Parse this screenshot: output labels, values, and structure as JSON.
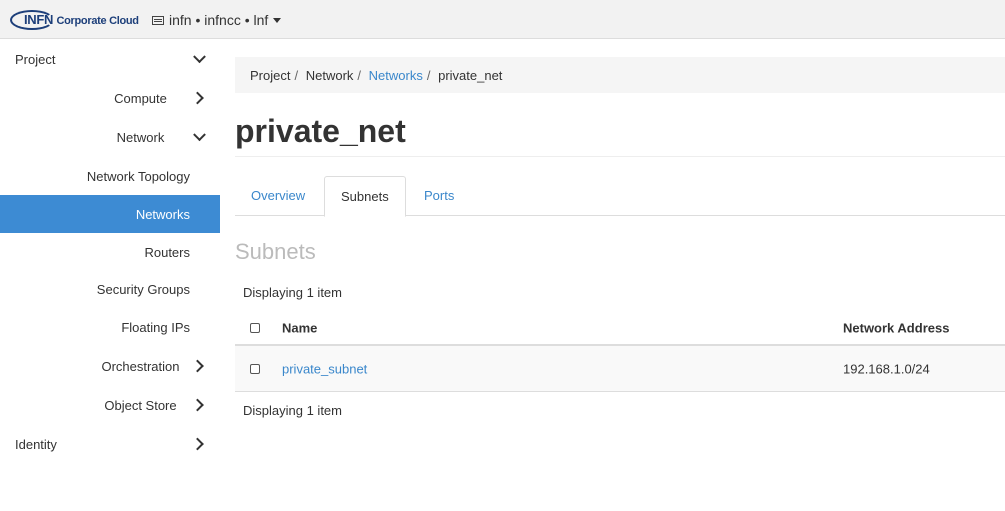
{
  "topbar": {
    "logo_brand": "INFN",
    "logo_sub": "Corporate Cloud",
    "project_selector": "infn • infncc • lnf"
  },
  "sidebar": {
    "items": [
      {
        "label": "Project",
        "level": 1,
        "chevron": "down"
      },
      {
        "label": "Compute",
        "level": 2,
        "chevron": "right"
      },
      {
        "label": "Network",
        "level": 2,
        "chevron": "down"
      },
      {
        "label": "Network Topology",
        "level": 3
      },
      {
        "label": "Networks",
        "level": 3,
        "active": true
      },
      {
        "label": "Routers",
        "level": 3
      },
      {
        "label": "Security Groups",
        "level": 3
      },
      {
        "label": "Floating IPs",
        "level": 3
      },
      {
        "label": "Orchestration",
        "level": 2,
        "chevron": "right"
      },
      {
        "label": "Object Store",
        "level": 2,
        "chevron": "right"
      },
      {
        "label": "Identity",
        "level": 1,
        "chevron": "right"
      }
    ]
  },
  "breadcrumb": [
    "Project",
    "Network",
    "Networks",
    "private_net"
  ],
  "title": "private_net",
  "tabs": [
    "Overview",
    "Subnets",
    "Ports"
  ],
  "active_tab": "Subnets",
  "section_title": "Subnets",
  "table": {
    "count_top": "Displaying 1 item",
    "count_bottom": "Displaying 1 item",
    "columns": [
      "Name",
      "Network Address"
    ],
    "rows": [
      {
        "name": "private_subnet",
        "network_address": "192.168.1.0/24"
      }
    ]
  },
  "colors": {
    "accent": "#3d8bd3",
    "link": "#3a87cb"
  }
}
